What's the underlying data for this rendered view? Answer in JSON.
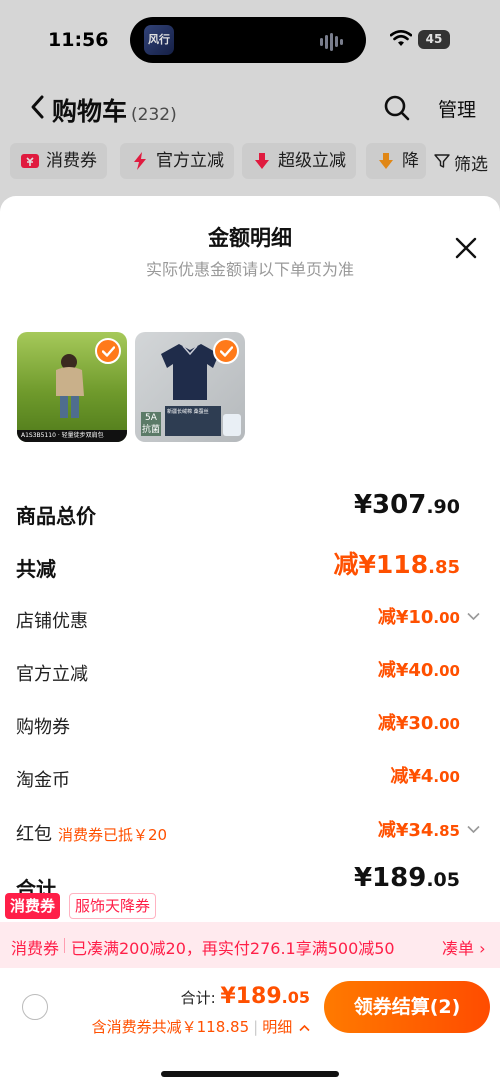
{
  "status_bar": {
    "time": "11:56",
    "battery": "45",
    "island_app": "风行"
  },
  "nav": {
    "title": "购物车",
    "count": "(232)",
    "manage": "管理"
  },
  "filters": [
    {
      "label": "消费券",
      "icon": "coupon-icon"
    },
    {
      "label": "官方立减",
      "icon": "lightning-icon"
    },
    {
      "label": "超级立减",
      "icon": "down-arrow-icon"
    },
    {
      "label": "降",
      "icon": "price-drop-icon"
    }
  ],
  "filter_button": "筛选",
  "sheet": {
    "title": "金额明细",
    "subtitle": "实际优惠金额请以下单页为准",
    "thumb1_caption": "A1S3B5110 · 轻量徒步双肩包",
    "thumb2_badge": "5A\n抗菌",
    "thumb2_caption": "新疆长绒棉 桑蚕丝",
    "rows": [
      {
        "label": "商品总价",
        "amount_int": "¥307",
        "amount_dec": ".90"
      },
      {
        "label": "共减",
        "amount_int": "减¥118",
        "amount_dec": ".85"
      },
      {
        "label": "店铺优惠",
        "amount_int": "减¥10",
        "amount_dec": ".00"
      },
      {
        "label": "官方立减",
        "amount_int": "减¥40",
        "amount_dec": ".00"
      },
      {
        "label": "购物券",
        "amount_int": "减¥30",
        "amount_dec": ".00"
      },
      {
        "label": "淘金币",
        "amount_int": "减¥4",
        "amount_dec": ".00"
      },
      {
        "label": "红包",
        "note": "消费券已抵￥20",
        "amount_int": "减¥34",
        "amount_dec": ".85"
      },
      {
        "label": "合计",
        "amount_int": "¥189",
        "amount_dec": ".05"
      }
    ]
  },
  "coupon_chips": {
    "consume": "消费券",
    "cloth": "服饰天降券"
  },
  "promo": {
    "tag": "消费券",
    "text": "已凑满200减20，再实付276.1享满500减50",
    "link": "凑单 ›"
  },
  "bottom": {
    "sum_label": "合计:",
    "sum_int": "¥189",
    "sum_dec": ".05",
    "discount": "含消费券共减￥118.85",
    "detail": "明细",
    "checkout": "领券结算(2)"
  },
  "colors": {
    "accent": "#ff5000",
    "coupon_red": "#ff1f48"
  }
}
